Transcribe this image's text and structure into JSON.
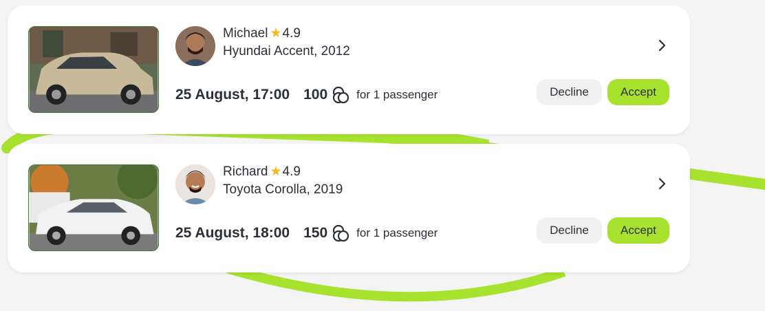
{
  "theme": {
    "accent": "#a6e22e",
    "star": "#f7b826",
    "background": "#f4f4f4",
    "card": "#ffffff"
  },
  "offers": [
    {
      "driver_name": "Michael",
      "rating": "4.9",
      "car": "Hyundai Accent, 2012",
      "datetime": "25 August, 17:00",
      "price": "100",
      "passengers": "for 1 passenger",
      "decline_label": "Decline",
      "accept_label": "Accept",
      "car_color": "#c8b99a",
      "icons": {
        "rating": "star-icon",
        "price": "coins-icon",
        "details": "chevron-right-icon"
      }
    },
    {
      "driver_name": "Richard",
      "rating": "4.9",
      "car": "Toyota Corolla, 2019",
      "datetime": "25 August, 18:00",
      "price": "150",
      "passengers": "for 1 passenger",
      "decline_label": "Decline",
      "accept_label": "Accept",
      "car_color": "#f2f2f2",
      "icons": {
        "rating": "star-icon",
        "price": "coins-icon",
        "details": "chevron-right-icon"
      }
    }
  ]
}
